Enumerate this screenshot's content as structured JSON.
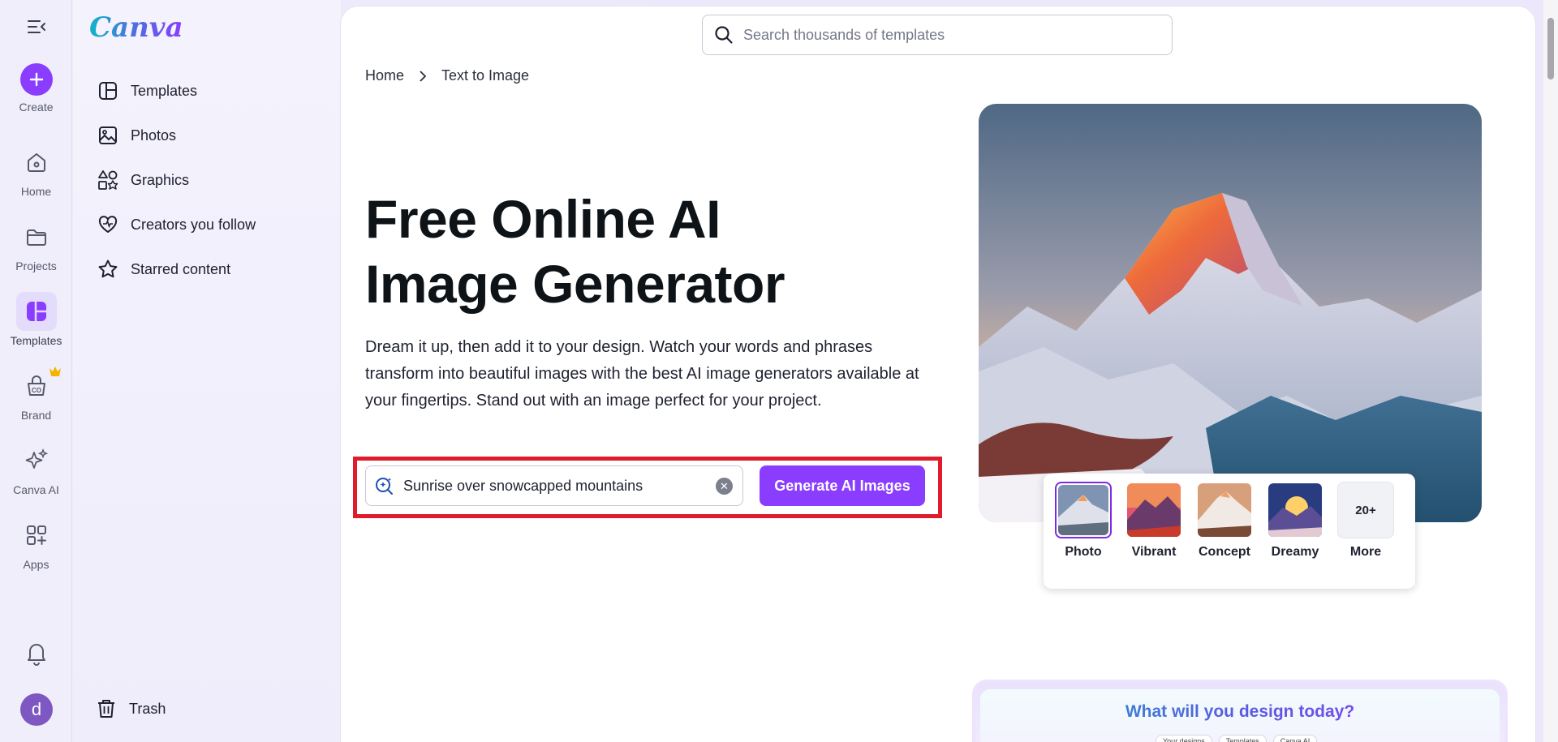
{
  "brand": {
    "logo_text": "Canva",
    "accent": "#8b3dff",
    "highlight_border": "#e01b2b"
  },
  "rail": {
    "items": [
      {
        "label": "Create",
        "icon": "plus-icon"
      },
      {
        "label": "Home",
        "icon": "home-icon"
      },
      {
        "label": "Projects",
        "icon": "folder-icon"
      },
      {
        "label": "Templates",
        "icon": "templates-icon"
      },
      {
        "label": "Brand",
        "icon": "brand-icon"
      },
      {
        "label": "Canva AI",
        "icon": "sparkle-icon"
      },
      {
        "label": "Apps",
        "icon": "apps-icon"
      }
    ],
    "avatar_letter": "d"
  },
  "sidebar": {
    "items": [
      {
        "label": "Templates",
        "icon": "template-layout-icon"
      },
      {
        "label": "Photos",
        "icon": "photo-icon"
      },
      {
        "label": "Graphics",
        "icon": "graphics-icon"
      },
      {
        "label": "Creators you follow",
        "icon": "heart-icon"
      },
      {
        "label": "Starred content",
        "icon": "star-icon"
      }
    ],
    "trash_label": "Trash"
  },
  "search": {
    "placeholder": "Search thousands of templates"
  },
  "breadcrumb": {
    "home": "Home",
    "current": "Text to Image"
  },
  "hero": {
    "title": "Free Online AI Image Generator",
    "description": "Dream it up, then add it to your design. Watch your words and phrases transform into beautiful images with the best AI image generators available at your fingertips. Stand out with an image perfect for your project."
  },
  "prompt": {
    "value": "Sunrise over snowcapped mountains",
    "button_label": "Generate AI Images"
  },
  "styles": {
    "options": [
      "Photo",
      "Vibrant",
      "Concept",
      "Dreamy"
    ],
    "more_count": "20+",
    "more_label": "More",
    "selected": "Photo"
  },
  "preview": {
    "title": "What will you design today?",
    "chips": [
      "Your designs",
      "Templates",
      "Canva AI"
    ]
  }
}
